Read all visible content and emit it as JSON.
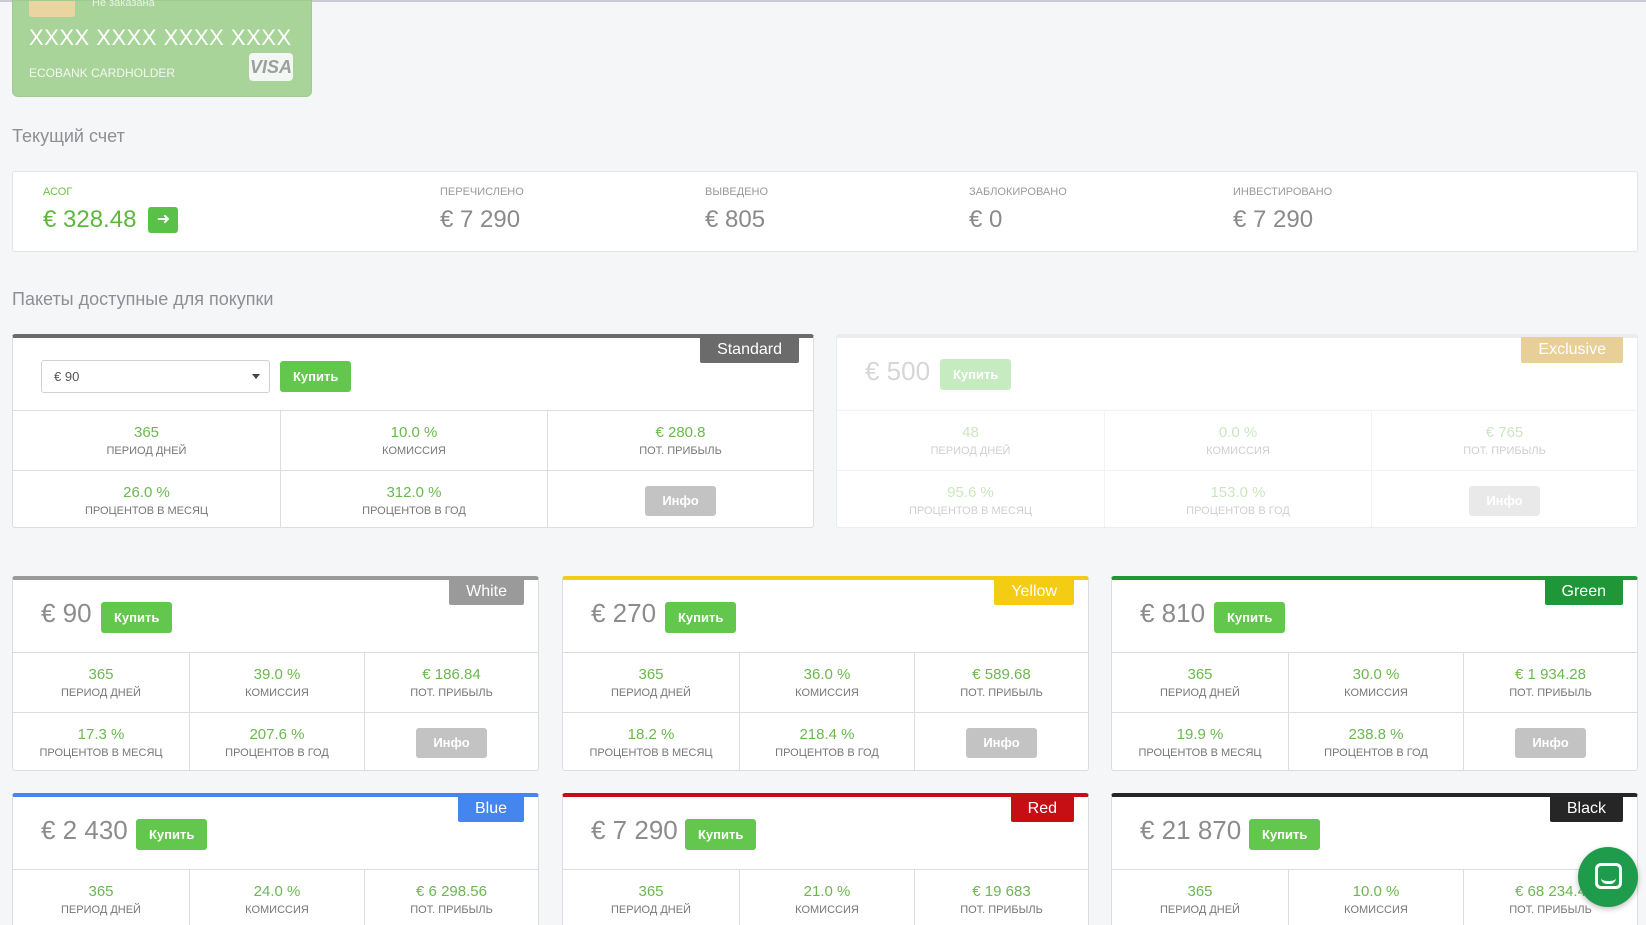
{
  "card": {
    "status": "Не заказана",
    "number": "XXXX XXXX XXXX XXXX",
    "holder": "ECOBANK CARDHOLDER",
    "brand": "VISA",
    "color": "#a8d49a"
  },
  "account": {
    "title": "Текущий счет",
    "columns": [
      {
        "label": "АСОГ",
        "value": "€ 328.48"
      },
      {
        "label": "ПЕРЕЧИСЛЕНО",
        "value": "€ 7 290"
      },
      {
        "label": "ВЫВЕДЕНО",
        "value": "€ 805"
      },
      {
        "label": "ЗАБЛОКИРОВАНО",
        "value": "€ 0"
      },
      {
        "label": "ИНВЕСТИРОВАНО",
        "value": "€ 7 290"
      }
    ],
    "transfer_icon": "arrow-right-icon"
  },
  "packages_title": "Пакеты доступные для покупки",
  "labels": {
    "period": "ПЕРИОД ДНЕЙ",
    "commission": "КОМИССИЯ",
    "profit": "ПОТ. ПРИБЫЛЬ",
    "per_month": "ПРОЦЕНТОВ В МЕСЯЦ",
    "per_year": "ПРОЦЕНТОВ В ГОД",
    "buy": "Купить",
    "info": "Инфо"
  },
  "standard": {
    "name": "Standard",
    "color": "#6b6b6b",
    "select_value": "€ 90",
    "period": "365",
    "commission": "10.0 %",
    "profit": "€ 280.8",
    "per_month": "26.0 %",
    "per_year": "312.0 %"
  },
  "exclusive": {
    "name": "Exclusive",
    "color": "#e8cf98",
    "price": "€ 500",
    "period": "48",
    "commission": "0.0 %",
    "profit": "€ 765",
    "per_month": "95.6 %",
    "per_year": "153.0 %"
  },
  "packages": [
    {
      "name": "White",
      "color": "#9a9a9a",
      "price": "€ 90",
      "period": "365",
      "commission": "39.0 %",
      "profit": "€ 186.84",
      "per_month": "17.3 %",
      "per_year": "207.6 %"
    },
    {
      "name": "Yellow",
      "color": "#f5cc14",
      "price": "€ 270",
      "period": "365",
      "commission": "36.0 %",
      "profit": "€ 589.68",
      "per_month": "18.2 %",
      "per_year": "218.4 %"
    },
    {
      "name": "Green",
      "color": "#1f9638",
      "price": "€ 810",
      "period": "365",
      "commission": "30.0 %",
      "profit": "€ 1 934.28",
      "per_month": "19.9 %",
      "per_year": "238.8 %"
    },
    {
      "name": "Blue",
      "color": "#4485ee",
      "price": "€ 2 430",
      "period": "365",
      "commission": "24.0 %",
      "profit": "€ 6 298.56"
    },
    {
      "name": "Red",
      "color": "#c60f14",
      "price": "€ 7 290",
      "period": "365",
      "commission": "21.0 %",
      "profit": "€ 19 683"
    },
    {
      "name": "Black",
      "color": "#262626",
      "price": "€ 21 870",
      "period": "365",
      "commission": "10.0 %",
      "profit": "€ 68 234.4"
    }
  ],
  "chat_icon": "chat-bubble-icon"
}
